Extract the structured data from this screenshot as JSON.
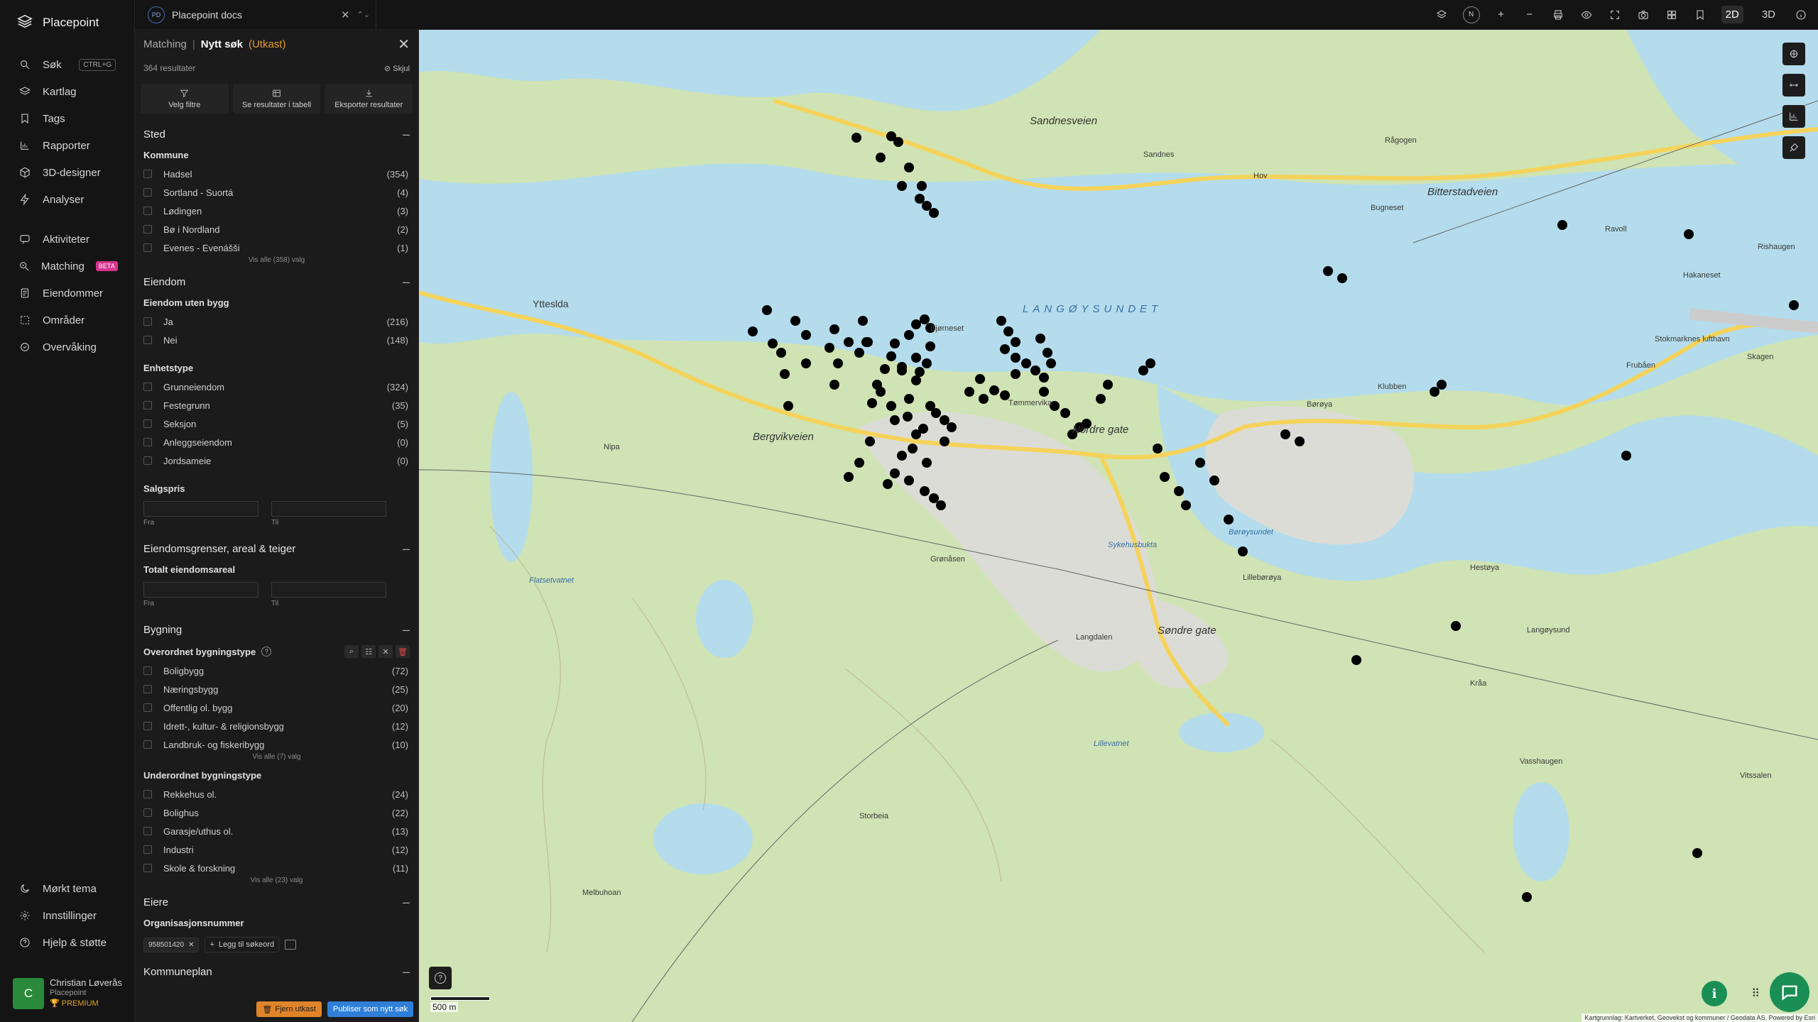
{
  "brand": {
    "name": "Placepoint"
  },
  "nav": {
    "items": [
      {
        "label": "Søk",
        "shortcut": "CTRL+G"
      },
      {
        "label": "Kartlag"
      },
      {
        "label": "Tags"
      },
      {
        "label": "Rapporter"
      },
      {
        "label": "3D-designer"
      },
      {
        "label": "Analyser"
      }
    ],
    "items2": [
      {
        "label": "Aktiviteter"
      },
      {
        "label": "Matching",
        "badge": "BETA"
      },
      {
        "label": "Eiendommer"
      },
      {
        "label": "Områder"
      },
      {
        "label": "Overvåking"
      }
    ],
    "bottom": [
      {
        "label": "Mørkt tema"
      },
      {
        "label": "Innstillinger"
      },
      {
        "label": "Hjelp & støtte"
      }
    ],
    "user": {
      "initial": "C",
      "name": "Christian Løverås",
      "org": "Placepoint",
      "plan": "PREMIUM"
    }
  },
  "topbar": {
    "workspace_badge": "PD",
    "workspace": "Placepoint docs",
    "compass": "N",
    "dim2d": "2D",
    "dim3d": "3D"
  },
  "panel": {
    "crumb": "Matching",
    "sep": "|",
    "title": "Nytt søk",
    "draft": "(Utkast)",
    "results": "364 resultater",
    "hide": "Skjul",
    "actions": {
      "filters": "Velg filtre",
      "table": "Se resultater i tabell",
      "export": "Eksporter resultater"
    },
    "sted": {
      "title": "Sted",
      "kommune_title": "Kommune",
      "kommune": [
        {
          "label": "Hadsel",
          "count": "(354)"
        },
        {
          "label": "Sortland - Suortá",
          "count": "(4)"
        },
        {
          "label": "Lødingen",
          "count": "(3)"
        },
        {
          "label": "Bø i Nordland",
          "count": "(2)"
        },
        {
          "label": "Evenes - Evenášši",
          "count": "(1)"
        }
      ],
      "more": "Vis alle (358) valg"
    },
    "eiendom": {
      "title": "Eiendom",
      "uten_bygg_title": "Eiendom uten bygg",
      "uten_bygg": [
        {
          "label": "Ja",
          "count": "(216)"
        },
        {
          "label": "Nei",
          "count": "(148)"
        }
      ],
      "enhet_title": "Enhetstype",
      "enhet": [
        {
          "label": "Grunneiendom",
          "count": "(324)"
        },
        {
          "label": "Festegrunn",
          "count": "(35)"
        },
        {
          "label": "Seksjon",
          "count": "(5)"
        },
        {
          "label": "Anleggseiendom",
          "count": "(0)"
        },
        {
          "label": "Jordsameie",
          "count": "(0)"
        }
      ],
      "salgspris_title": "Salgspris",
      "from": "Fra",
      "to": "Til"
    },
    "grenser": {
      "title": "Eiendomsgrenser, areal & teiger",
      "areal_title": "Totalt eiendomsareal",
      "from": "Fra",
      "to": "Til"
    },
    "bygning": {
      "title": "Bygning",
      "over_title": "Overordnet bygningstype",
      "over": [
        {
          "label": "Boligbygg",
          "count": "(72)"
        },
        {
          "label": "Næringsbygg",
          "count": "(25)"
        },
        {
          "label": "Offentlig ol. bygg",
          "count": "(20)"
        },
        {
          "label": "Idrett-, kultur- & religionsbygg",
          "count": "(12)"
        },
        {
          "label": "Landbruk- og fiskeribygg",
          "count": "(10)"
        }
      ],
      "over_more": "Vis alle (7) valg",
      "under_title": "Underordnet bygningstype",
      "under": [
        {
          "label": "Rekkehus ol.",
          "count": "(24)"
        },
        {
          "label": "Bolighus",
          "count": "(22)"
        },
        {
          "label": "Garasje/uthus ol.",
          "count": "(13)"
        },
        {
          "label": "Industri",
          "count": "(12)"
        },
        {
          "label": "Skole & forskning",
          "count": "(11)"
        }
      ],
      "under_more": "Vis alle (23) valg"
    },
    "eiere": {
      "title": "Eiere",
      "org_title": "Organisasjonsnummer",
      "chip": "958501420",
      "add": "Legg til søkeord"
    },
    "kommuneplan": {
      "title": "Kommuneplan"
    },
    "footer": {
      "remove": "Fjern utkast",
      "publish": "Publiser som nytt søk"
    }
  },
  "map": {
    "scale": "500 m",
    "attribution": "Kartgrunnlag: Kartverket, Geovekst og kommuner / Geodata AS. Powered by Esri",
    "labels": {
      "sea": "LANGØYSUNDET",
      "road1": "Bergvikveien",
      "road2": "Nordre gate",
      "road3": "Søndre gate",
      "road4": "Sandnesveien",
      "road5": "Bitterstadveien",
      "place1": "Sandnes",
      "place2": "Ytteslda",
      "place3": "Bjørneset",
      "place4": "Tømmervika",
      "place5": "Børøya",
      "place6": "Stokmarknes lufthavn",
      "place7": "Børøysundet",
      "place8": "Hestøya",
      "place9": "Lillebørøya",
      "place10": "Sykehusbukta",
      "place11": "Langdalen",
      "place12": "Vasshaugen",
      "place13": "Langøysund",
      "place14": "Kråa",
      "place15": "Rishaugen",
      "place16": "Hakaneset",
      "place17": "Ravoll",
      "place18": "Skagen",
      "place19": "Frubåen",
      "place20": "Klubben",
      "place21": "Nipa",
      "place22": "Hov",
      "place23": "Bugneset",
      "place24": "Rågogen",
      "place25": "Lillevatnet",
      "place26": "Storbeia",
      "place27": "Melbuhoan",
      "place28": "Vitssalen",
      "place29": "Grønåsen",
      "place30": "Flatsetvatnet"
    }
  }
}
